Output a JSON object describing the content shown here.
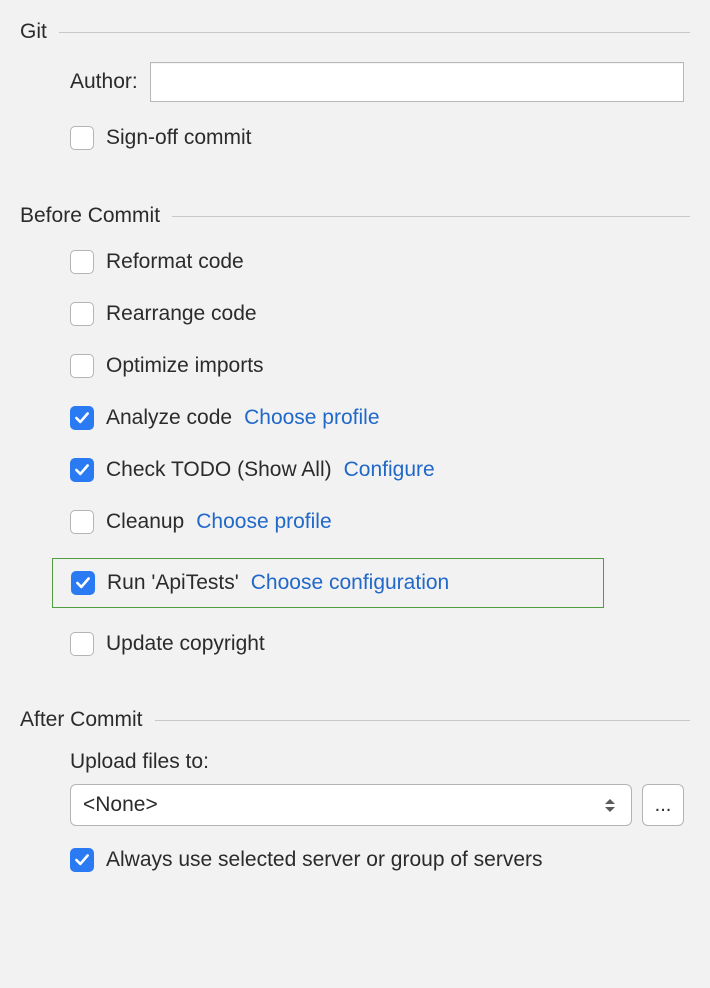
{
  "git": {
    "title": "Git",
    "author_label": "Author:",
    "author_value": "",
    "signoff": {
      "label": "Sign-off commit",
      "checked": false
    }
  },
  "before": {
    "title": "Before Commit",
    "items": [
      {
        "label": "Reformat code",
        "checked": false,
        "link": null
      },
      {
        "label": "Rearrange code",
        "checked": false,
        "link": null
      },
      {
        "label": "Optimize imports",
        "checked": false,
        "link": null
      },
      {
        "label": "Analyze code",
        "checked": true,
        "link": "Choose profile"
      },
      {
        "label": "Check TODO (Show All)",
        "checked": true,
        "link": "Configure"
      },
      {
        "label": "Cleanup",
        "checked": false,
        "link": "Choose profile"
      },
      {
        "label": "Run 'ApiTests'",
        "checked": true,
        "link": "Choose configuration",
        "highlighted": true
      },
      {
        "label": "Update copyright",
        "checked": false,
        "link": null
      }
    ]
  },
  "after": {
    "title": "After Commit",
    "upload_label": "Upload files to:",
    "upload_value": "<None>",
    "ellipsis": "...",
    "always_use": {
      "label": "Always use selected server or group of servers",
      "checked": true
    }
  }
}
